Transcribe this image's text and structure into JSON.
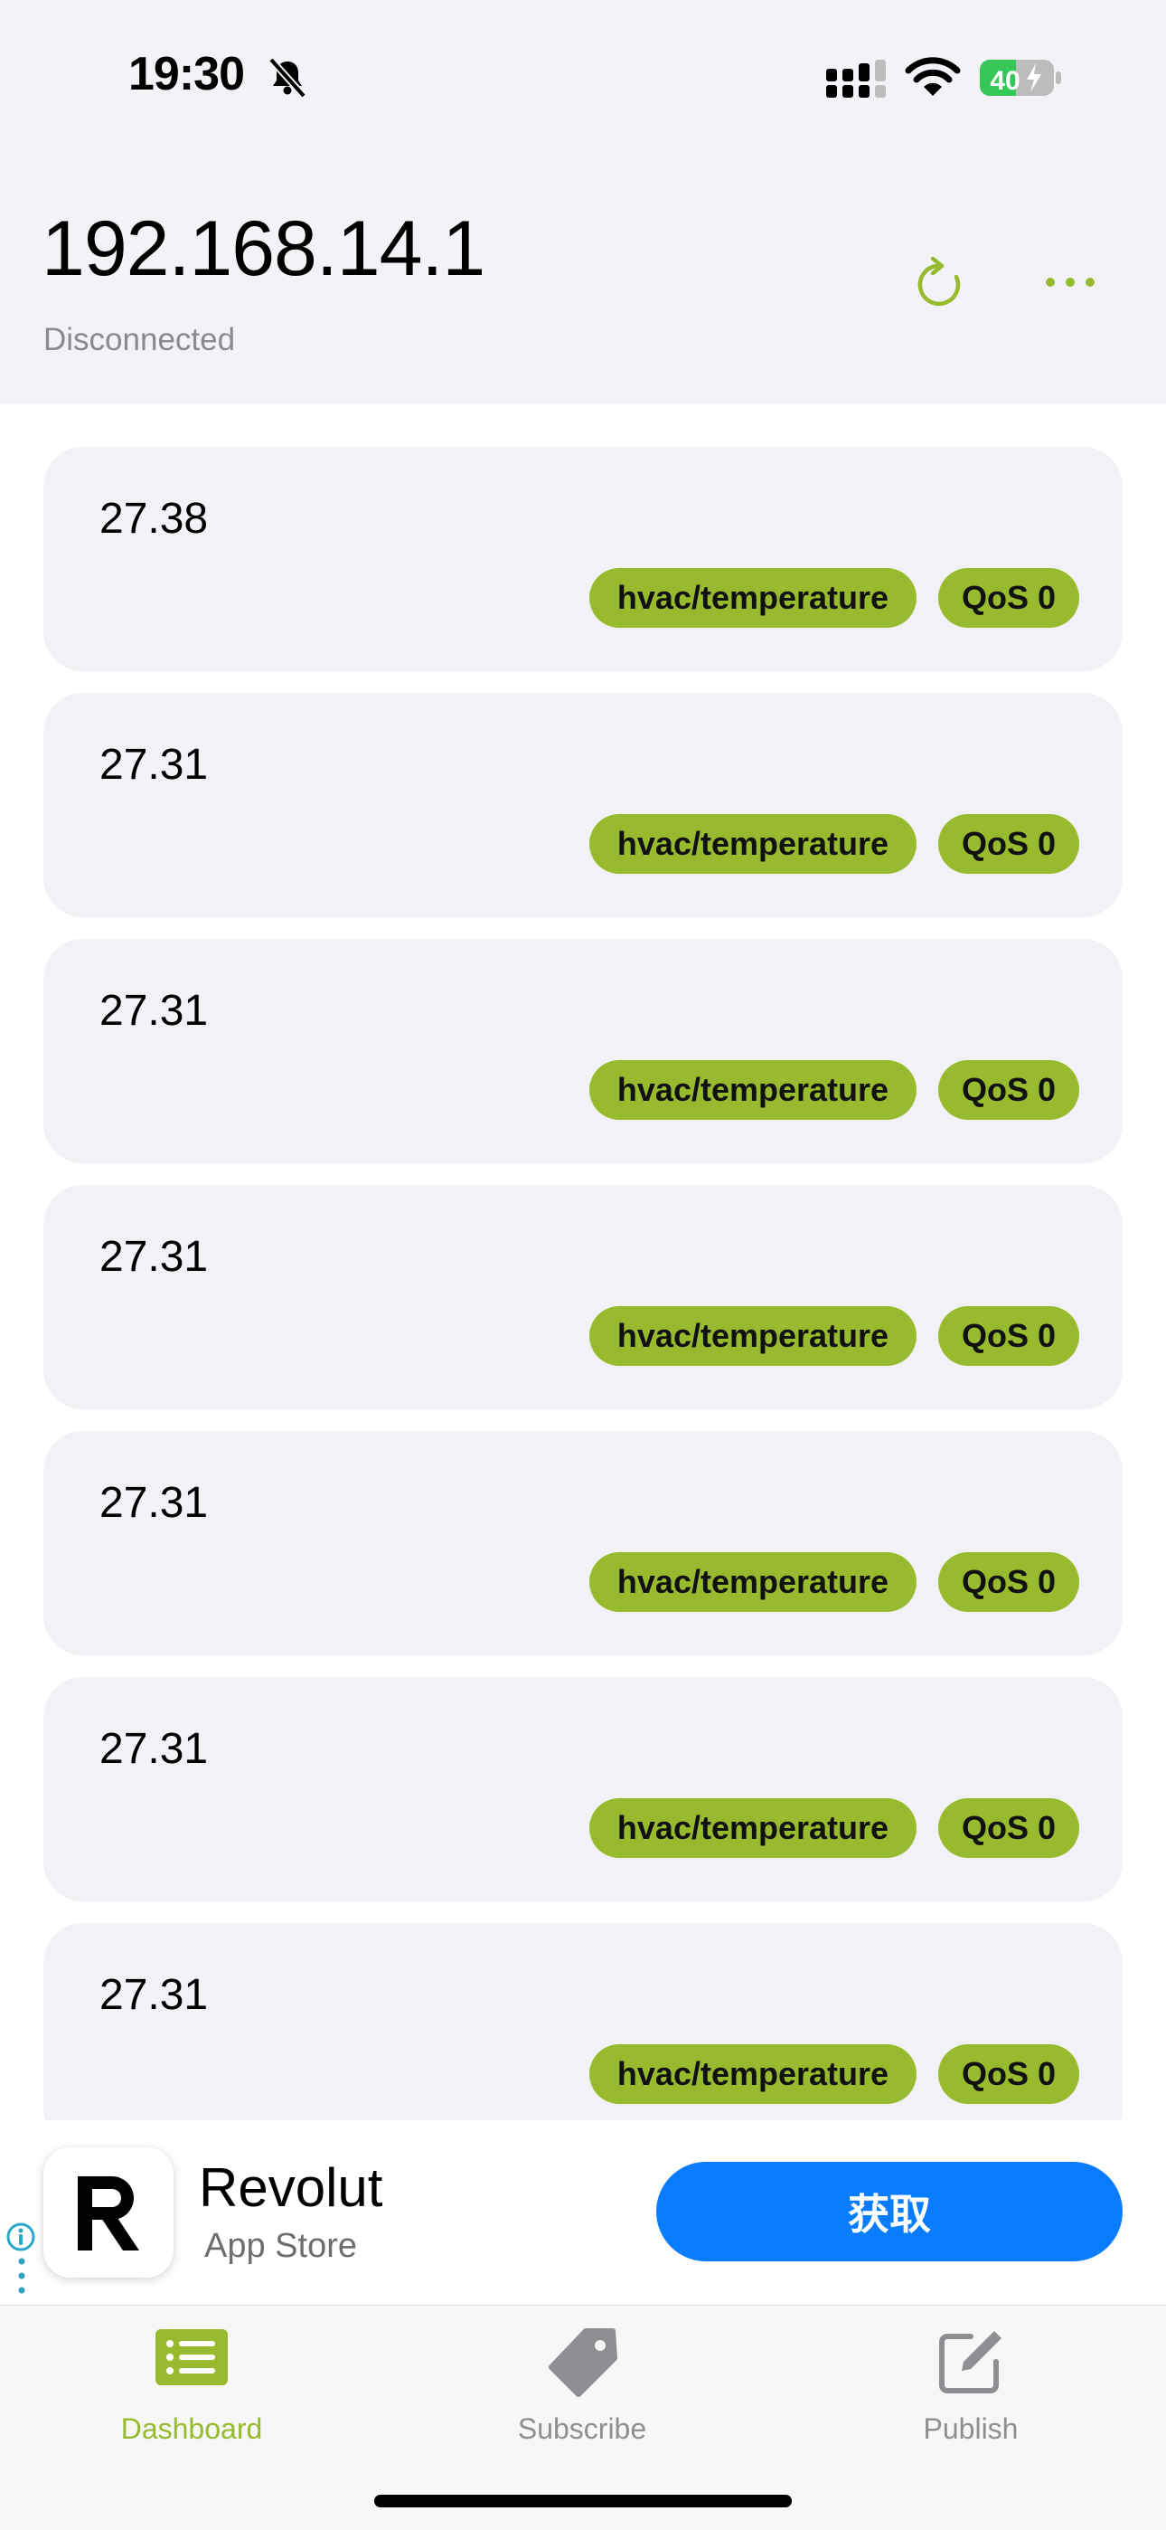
{
  "status_bar": {
    "time": "19:30",
    "battery": "40"
  },
  "header": {
    "title": "192.168.14.1",
    "status": "Disconnected"
  },
  "messages": [
    {
      "value": "27.38",
      "topic": "hvac/temperature",
      "qos": "QoS 0"
    },
    {
      "value": "27.31",
      "topic": "hvac/temperature",
      "qos": "QoS 0"
    },
    {
      "value": "27.31",
      "topic": "hvac/temperature",
      "qos": "QoS 0"
    },
    {
      "value": "27.31",
      "topic": "hvac/temperature",
      "qos": "QoS 0"
    },
    {
      "value": "27.31",
      "topic": "hvac/temperature",
      "qos": "QoS 0"
    },
    {
      "value": "27.31",
      "topic": "hvac/temperature",
      "qos": "QoS 0"
    },
    {
      "value": "27.31",
      "topic": "hvac/temperature",
      "qos": "QoS 0"
    }
  ],
  "ad": {
    "title": "Revolut",
    "subtitle": "App Store",
    "button": "获取"
  },
  "tabs": [
    {
      "label": "Dashboard",
      "icon": "list-icon",
      "active": true
    },
    {
      "label": "Subscribe",
      "icon": "tag-icon",
      "active": false
    },
    {
      "label": "Publish",
      "icon": "edit-icon",
      "active": false
    }
  ],
  "colors": {
    "accent": "#97ba2e",
    "ad_button": "#0a7cff",
    "header_bg": "#f2f2f7",
    "card_bg": "#f1f1f6"
  }
}
